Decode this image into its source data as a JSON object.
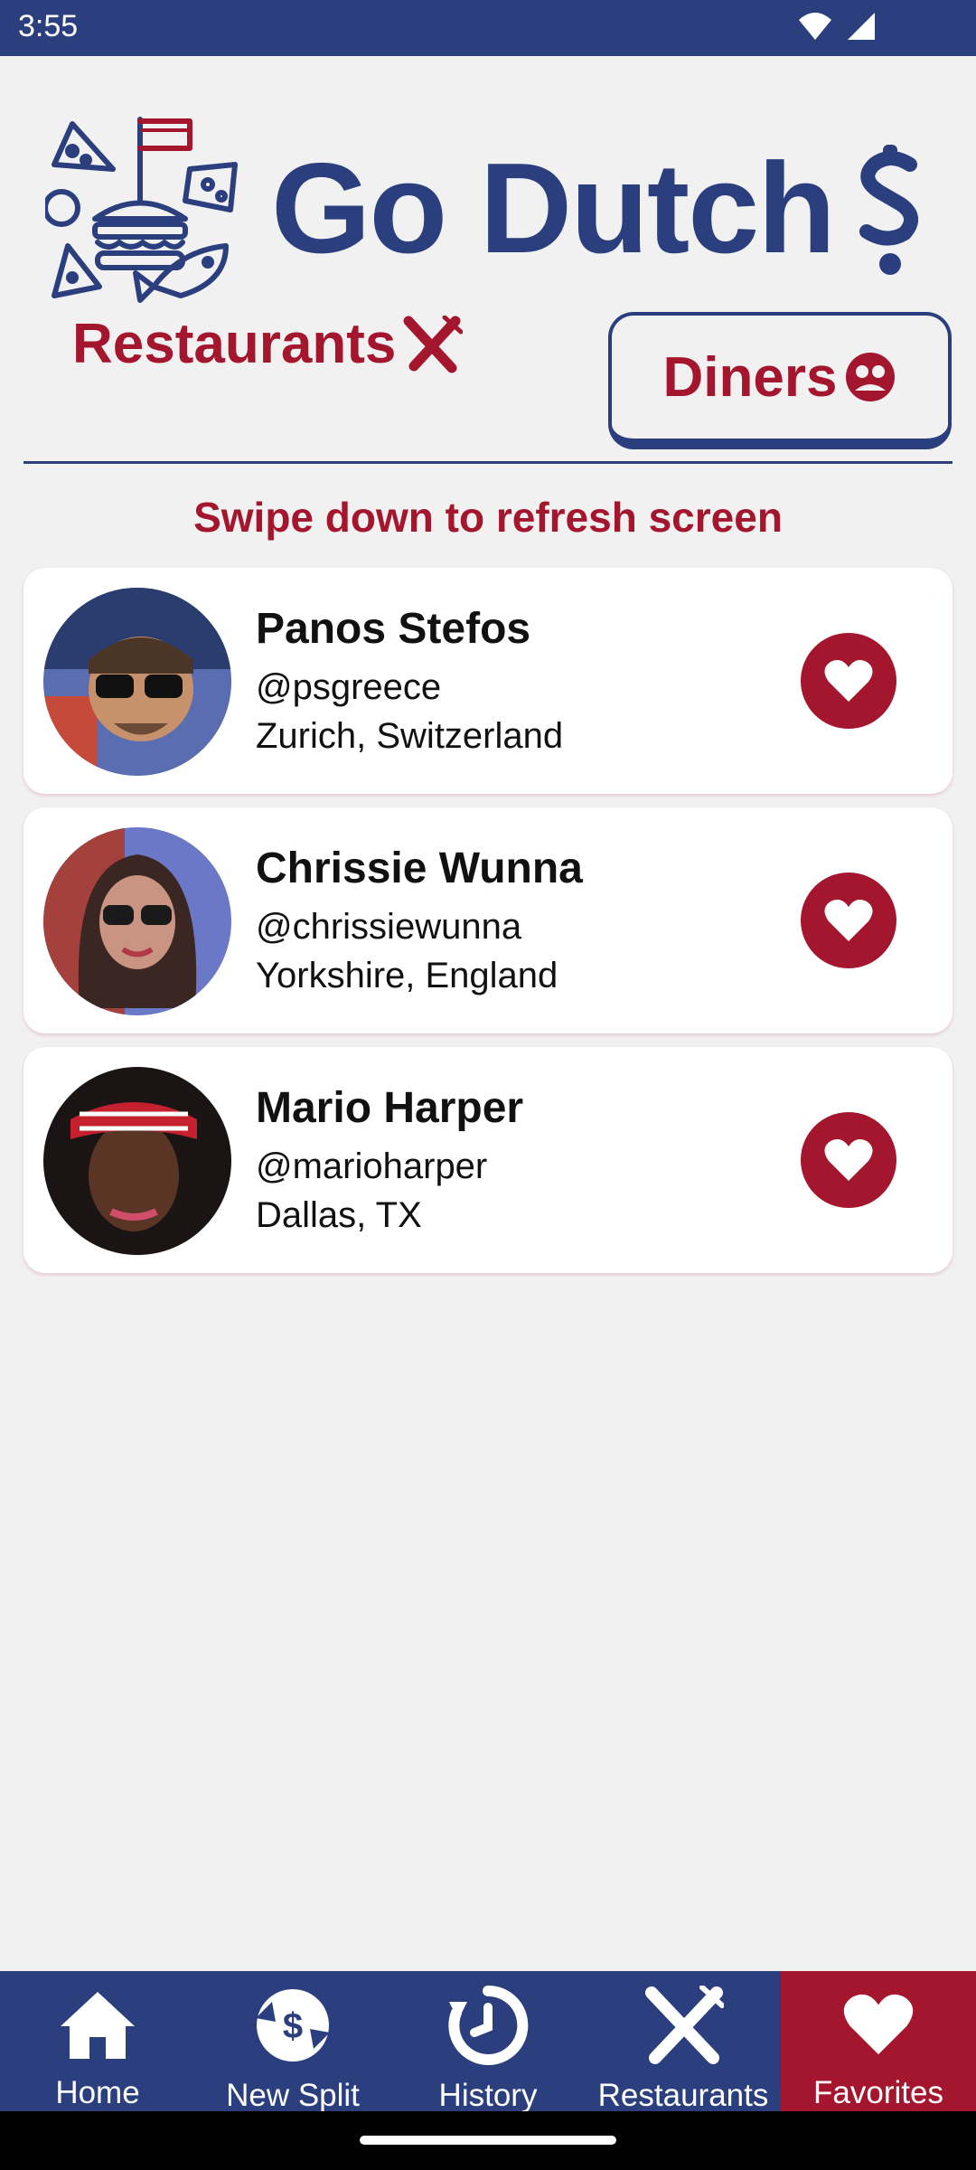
{
  "status_bar": {
    "time": "3:55"
  },
  "header": {
    "app_title": "Go Dutch",
    "title_symbol": "$"
  },
  "tabs": {
    "restaurants_label": "Restaurants",
    "diners_label": "Diners"
  },
  "hint": "Swipe down to refresh screen",
  "diners": [
    {
      "name": "Panos Stefos",
      "handle": "@psgreece",
      "location": "Zurich, Switzerland"
    },
    {
      "name": "Chrissie Wunna",
      "handle": "@chrissiewunna",
      "location": "Yorkshire, England"
    },
    {
      "name": "Mario Harper",
      "handle": "@marioharper",
      "location": "Dallas, TX"
    }
  ],
  "bottom_nav": {
    "home": "Home",
    "new_split": "New Split",
    "history": "History",
    "restaurants": "Restaurants",
    "favorites": "Favorites",
    "active": "favorites"
  },
  "colors": {
    "navy": "#2b3f7e",
    "crimson": "#a3162d",
    "background": "#f2f1f2"
  }
}
